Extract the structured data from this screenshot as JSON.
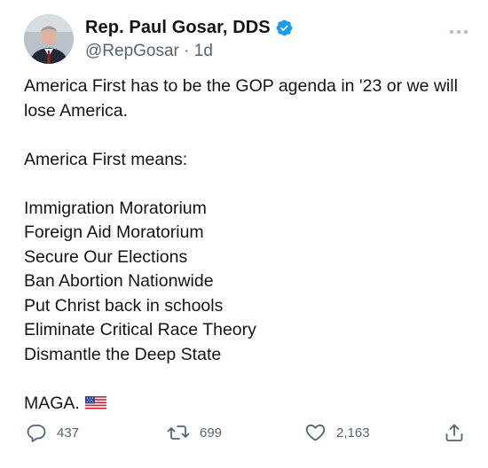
{
  "author": {
    "display_name": "Rep. Paul Gosar, DDS",
    "handle": "@RepGosar",
    "separator": " · ",
    "time_ago": "1d"
  },
  "tweet": {
    "intro": "America First has to be the GOP agenda in '23 or we will lose America.",
    "means_heading": "America First means:",
    "items": [
      "Immigration Moratorium",
      "Foreign Aid Moratorium",
      "Secure Our Elections",
      "Ban Abortion Nationwide",
      "Put Christ back in schools",
      "Eliminate Critical Race Theory",
      "Dismantle the Deep State"
    ],
    "closing": "MAGA."
  },
  "actions": {
    "reply_count": "437",
    "retweet_count": "699",
    "like_count": "2,163"
  },
  "icons": {
    "more": "more-horizontal-icon",
    "verified": "verified-badge-icon",
    "reply": "reply-icon",
    "retweet": "retweet-icon",
    "like": "heart-icon",
    "share": "share-icon",
    "flag": "us-flag-emoji"
  },
  "colors": {
    "text": "#0f1419",
    "secondary": "#536471",
    "verified": "#1d9bf0"
  }
}
